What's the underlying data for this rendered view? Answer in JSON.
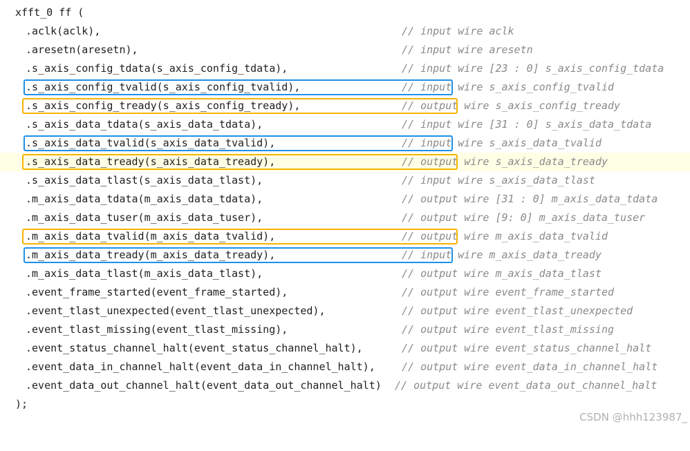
{
  "code": {
    "header": "xfft_0 ff (",
    "footer": ");",
    "lines": [
      {
        "text": ".aclk(aclk),",
        "comment": "// input wire aclk"
      },
      {
        "text": ".aresetn(aresetn),",
        "comment": "// input wire aresetn"
      },
      {
        "text": ".s_axis_config_tdata(s_axis_config_tdata),",
        "comment": "// input wire [23 : 0] s_axis_config_tdata"
      },
      {
        "text": ".s_axis_config_tvalid(s_axis_config_tvalid),",
        "comment": "// input wire s_axis_config_tvalid",
        "box": "blue"
      },
      {
        "text": ".s_axis_config_tready(s_axis_config_tready),",
        "comment": "// output wire s_axis_config_tready",
        "box": "orange"
      },
      {
        "text": ".s_axis_data_tdata(s_axis_data_tdata),",
        "comment": "// input wire [31 : 0] s_axis_data_tdata"
      },
      {
        "text": ".s_axis_data_tvalid(s_axis_data_tvalid),",
        "comment": "// input wire s_axis_data_tvalid",
        "box": "blue"
      },
      {
        "text": ".s_axis_data_tready(s_axis_data_tready),",
        "comment": "// output wire s_axis_data_tready",
        "box": "orange",
        "highlight": true
      },
      {
        "text": ".s_axis_data_tlast(s_axis_data_tlast),",
        "comment": "// input wire s_axis_data_tlast"
      },
      {
        "text": ".m_axis_data_tdata(m_axis_data_tdata),",
        "comment": "// output wire [31 : 0] m_axis_data_tdata"
      },
      {
        "text": ".m_axis_data_tuser(m_axis_data_tuser),",
        "comment": "// output wire [9: 0] m_axis_data_tuser"
      },
      {
        "text": ".m_axis_data_tvalid(m_axis_data_tvalid),",
        "comment": "// output wire m_axis_data_tvalid",
        "box": "orange"
      },
      {
        "text": ".m_axis_data_tready(m_axis_data_tready),",
        "comment": "// input wire m_axis_data_tready",
        "box": "blue"
      },
      {
        "text": ".m_axis_data_tlast(m_axis_data_tlast),",
        "comment": "// output wire m_axis_data_tlast"
      },
      {
        "text": ".event_frame_started(event_frame_started),",
        "comment": "// output wire event_frame_started"
      },
      {
        "text": ".event_tlast_unexpected(event_tlast_unexpected),",
        "comment": "// output wire event_tlast_unexpected"
      },
      {
        "text": ".event_tlast_missing(event_tlast_missing),",
        "comment": "// output wire event_tlast_missing"
      },
      {
        "text": ".event_status_channel_halt(event_status_channel_halt),",
        "comment": "// output wire event_status_channel_halt"
      },
      {
        "text": ".event_data_in_channel_halt(event_data_in_channel_halt),",
        "comment": "// output wire event_data_in_channel_halt"
      },
      {
        "text": ".event_data_out_channel_halt(event_data_out_channel_halt)",
        "comment": "// output wire event_data_out_channel_halt"
      }
    ]
  },
  "watermark": "CSDN @hhh123987_",
  "colors": {
    "blue_box": "#1e90e8",
    "orange_box": "#f5b400",
    "highlight": "#ffffe6",
    "comment": "#8a8a8a"
  }
}
